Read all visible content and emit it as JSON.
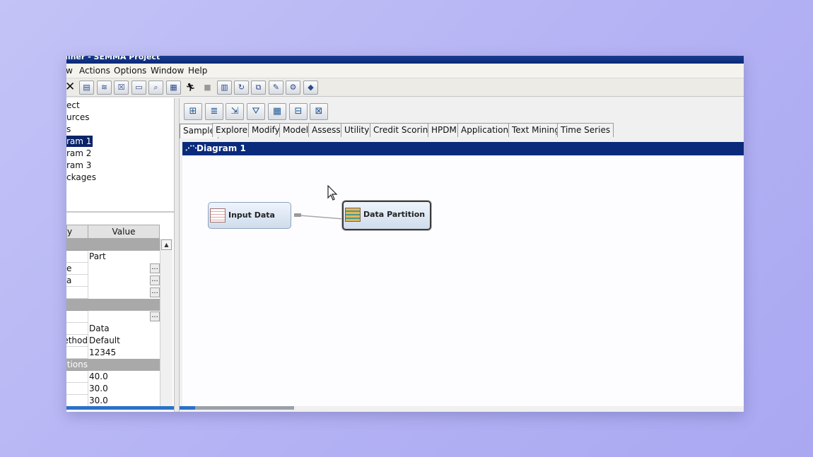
{
  "window": {
    "title_fragment": "niner - SEMMA Project"
  },
  "menu": [
    "w",
    "Actions",
    "Options",
    "Window",
    "Help"
  ],
  "toolbar": {
    "close_glyph": "✕"
  },
  "tree": {
    "items": [
      {
        "label": "ect",
        "selected": false
      },
      {
        "label": "urces",
        "selected": false
      },
      {
        "label": "s",
        "selected": false
      },
      {
        "label": "ram 1",
        "selected": true
      },
      {
        "label": "ram 2",
        "selected": false
      },
      {
        "label": "ram 3",
        "selected": false
      },
      {
        "label": "ckages",
        "selected": false
      }
    ]
  },
  "properties": {
    "header_name": "y",
    "header_value": "Value",
    "rows": [
      {
        "name": "",
        "value": "",
        "group": true
      },
      {
        "name": "",
        "value": "Part"
      },
      {
        "name": "e",
        "value": "",
        "ellipsis": true
      },
      {
        "name": "a",
        "value": "",
        "ellipsis": true
      },
      {
        "name": "",
        "value": "",
        "ellipsis": true
      },
      {
        "name": "",
        "value": "",
        "group": true
      },
      {
        "name": "",
        "value": "",
        "ellipsis": true
      },
      {
        "name": "",
        "value": "Data"
      },
      {
        "name": "ethod",
        "value": "Default"
      },
      {
        "name": "",
        "value": "12345"
      },
      {
        "name": "ations",
        "value": "",
        "group": true
      },
      {
        "name": "",
        "value": "40.0"
      },
      {
        "name": "",
        "value": "30.0"
      },
      {
        "name": "",
        "value": "30.0"
      }
    ]
  },
  "tabs": [
    "Sample",
    "Explore",
    "Modify",
    "Model",
    "Assess",
    "Utility",
    "Credit Scoring",
    "HPDM",
    "Applications",
    "Text Mining",
    "Time Series"
  ],
  "active_tab": "Sample",
  "diagram": {
    "title": "Diagram 1",
    "nodes": [
      {
        "id": "input-data",
        "label": "Input Data",
        "selected": false
      },
      {
        "id": "data-partition",
        "label": "Data Partition",
        "selected": true
      }
    ]
  },
  "colors": {
    "titlebar": "#0b2a78",
    "selection": "#0a246a",
    "diagram_header": "#0a2a7c",
    "background": "#b4b2f4"
  }
}
